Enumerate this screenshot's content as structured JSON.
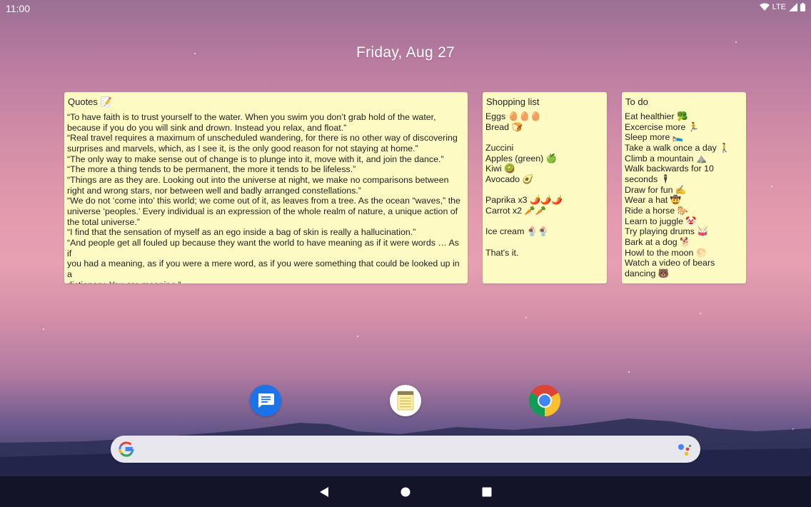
{
  "status_bar": {
    "time": "11:00",
    "network": "LTE"
  },
  "date": "Friday, Aug 27",
  "widgets": {
    "quotes": {
      "title": "Quotes 📝",
      "lines": [
        "“To have faith is to trust yourself to the water. When you swim you don’t grab hold of the water,",
        "because if you do you will sink and drown. Instead you relax, and float.”",
        "“Real travel requires a maximum of unscheduled wandering, for there is no other way of discovering",
        "surprises and marvels, which, as I see it, is the only good reason for not staying at home.”",
        "“The only way to make sense out of change is to plunge into it, move with it, and join the dance.”",
        "“The more a thing tends to be permanent, the more it tends to be lifeless.”",
        "“Things are as they are. Looking out into the universe at night, we make no comparisons between",
        "right and wrong stars, nor between well and badly arranged constellations.”",
        "“We do not ‘come into’ this world; we come out of it, as leaves from a tree. As the ocean “waves,” the",
        "universe ‘peoples.’ Every individual is an expression of the whole realm of nature, a unique action of",
        "the total universe.”",
        "“I find that the sensation of myself as an ego inside a bag of skin is really a hallucination.”",
        "“And people get all fouled up because they want the world to have meaning as if it were words … As if",
        "you had a meaning, as if you were a mere word, as if you were something that could be looked up in a",
        "dictionary. You are meaning.”"
      ]
    },
    "shopping": {
      "title": "Shopping list",
      "lines": [
        "Eggs 🥚🥚🥚",
        "Bread 🍞",
        "",
        "Zuccini",
        "Apples (green) 🍏",
        "Kiwi 🥝",
        "Avocado 🥑",
        "",
        "Paprika x3 🌶️🌶️🌶️",
        "Carrot x2 🥕🥕",
        "",
        "Ice cream 🍨🍨",
        "",
        "That's it."
      ]
    },
    "todo": {
      "title": "To do",
      "lines": [
        "Eat healthier 🥦",
        "Excercise more 🏃",
        "Sleep more 🛌",
        "Take a walk once a day 🚶",
        "Climb a mountain ⛰️",
        "Walk backwards for 10",
        "seconds 🕴️",
        "Draw for fun ✍️",
        "Wear a hat 🤠",
        "Ride a horse 🐎",
        "Learn to juggle 🤡",
        "Try playing drums 🥁",
        "Bark at a dog 🐕",
        "Howl to the moon 🌕",
        "Watch a video of bears",
        "dancing 🐻"
      ]
    }
  },
  "dock": [
    {
      "icon": "messages-icon"
    },
    {
      "icon": "notes-icon"
    },
    {
      "icon": "chrome-icon"
    }
  ],
  "search": {
    "icon": "google-g-icon",
    "assistant_icon": "google-assistant-icon"
  },
  "colors": {
    "note_bg": "#fdfac3",
    "nav_bg": "#141428",
    "search_bg": "#e9e7ee",
    "messages_blue": "#1a73e8"
  }
}
